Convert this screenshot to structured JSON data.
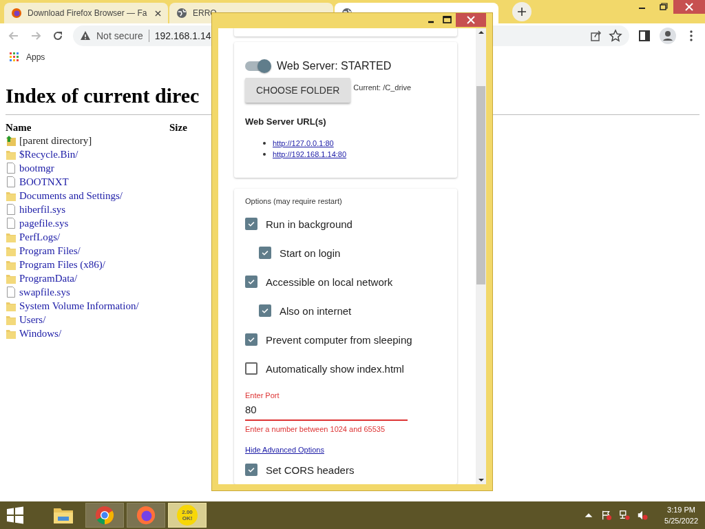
{
  "browser": {
    "tabs": [
      {
        "title": "Download Firefox Browser — Fa",
        "selected": false
      },
      {
        "title": "ERRO",
        "selected": false
      },
      {
        "selected": true
      }
    ],
    "security": "Not secure",
    "url": "192.168.1.14",
    "bookmarks": [
      "Apps"
    ]
  },
  "page": {
    "heading": "Index of current direc",
    "columns": [
      "Name",
      "Size"
    ],
    "entries": [
      {
        "name": "[parent directory]",
        "kind": "parent"
      },
      {
        "name": "$Recycle.Bin/",
        "kind": "folder"
      },
      {
        "name": "bootmgr",
        "kind": "file"
      },
      {
        "name": "BOOTNXT",
        "kind": "file"
      },
      {
        "name": "Documents and Settings/",
        "kind": "folder"
      },
      {
        "name": "hiberfil.sys",
        "kind": "file"
      },
      {
        "name": "pagefile.sys",
        "kind": "file"
      },
      {
        "name": "PerfLogs/",
        "kind": "folder"
      },
      {
        "name": "Program Files/",
        "kind": "folder"
      },
      {
        "name": "Program Files (x86)/",
        "kind": "folder"
      },
      {
        "name": "ProgramData/",
        "kind": "folder"
      },
      {
        "name": "swapfile.sys",
        "kind": "file"
      },
      {
        "name": "System Volume Information/",
        "kind": "folder"
      },
      {
        "name": "Users/",
        "kind": "folder"
      },
      {
        "name": "Windows/",
        "kind": "folder"
      }
    ]
  },
  "server_window": {
    "server": {
      "label": "Web Server: STARTED",
      "on": true
    },
    "choose_button": "CHOOSE FOLDER",
    "current": "Current: /C_drive",
    "urls_heading": "Web Server URL(s)",
    "urls": [
      "http://127.0.0.1:80",
      "http://192.168.1.14:80"
    ],
    "options_heading": "Options (may require restart)",
    "options": [
      {
        "label": "Run in background",
        "checked": true,
        "children": [
          {
            "label": "Start on login",
            "checked": true
          }
        ]
      },
      {
        "label": "Accessible on local network",
        "checked": true,
        "children": [
          {
            "label": "Also on internet",
            "checked": true
          }
        ]
      },
      {
        "label": "Prevent computer from sleeping",
        "checked": true
      },
      {
        "label": "Automatically show index.html",
        "checked": false
      }
    ],
    "port": {
      "label": "Enter Port",
      "value": "80",
      "error": "Enter a number between 1024 and 65535"
    },
    "advanced_link": "Hide Advanced Options",
    "more_options": [
      {
        "label": "Set CORS headers",
        "checked": true
      }
    ]
  },
  "taskbar": {
    "apps": [
      {
        "kind": "explorer",
        "selected": false
      },
      {
        "kind": "chrome",
        "selected": false
      },
      {
        "kind": "firefox",
        "selected": false
      },
      {
        "kind": "server",
        "label": "2.00 OK!",
        "selected": true
      }
    ],
    "time": "3:19 PM",
    "date": "5/25/2022"
  }
}
